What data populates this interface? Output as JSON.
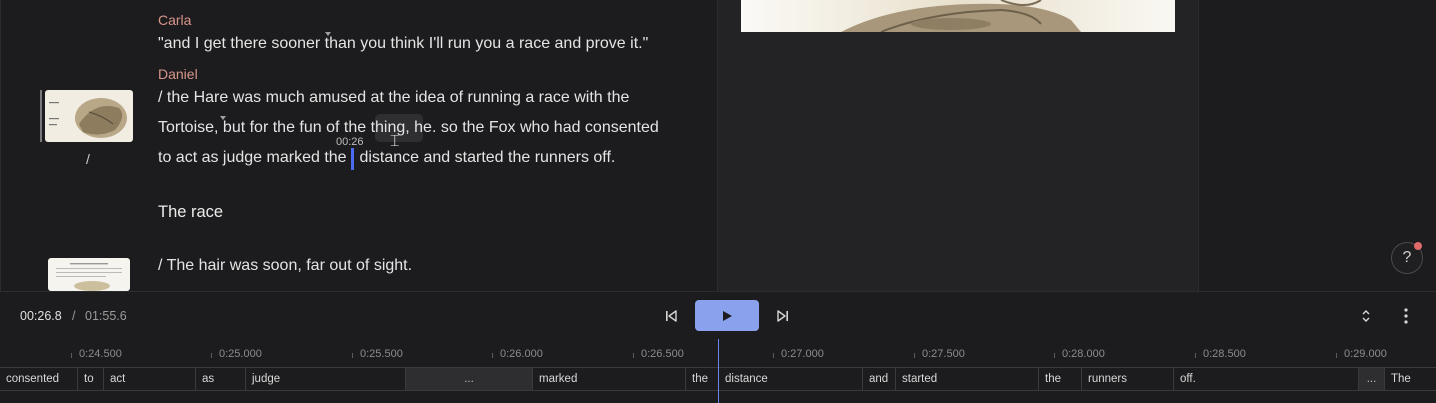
{
  "transcript": {
    "block1": {
      "speaker": "Carla",
      "text": "\"and I get there sooner than you think I'll run you a race and prove it.\""
    },
    "block2": {
      "speaker": "Daniel",
      "line1": "/ the Hare was much amused at the idea of running a race with the",
      "line2": "Tortoise, but for the fun of the thing, he. so the Fox who had consented",
      "line3a": "to act as judge marked the",
      "line3b": "distance and started the runners off.",
      "thumb_label": "/",
      "cursor_time": "00:26"
    },
    "heading": "The race",
    "block3": {
      "text": "/ The hair was soon, far out of sight."
    }
  },
  "player": {
    "current_time": "00:26.8",
    "separator": "/",
    "total_time": "01:55.6"
  },
  "timeline": {
    "ticks": [
      "0:24.500",
      "0:25.000",
      "0:25.500",
      "0:26.000",
      "0:26.500",
      "0:27.000",
      "0:27.500",
      "0:28.000",
      "0:28.500",
      "0:29.000"
    ],
    "words": [
      "consented",
      "to",
      "act",
      "as",
      "judge",
      "...",
      "marked",
      "the",
      "distance",
      "and",
      "started",
      "the",
      "runners",
      "off.",
      "...",
      "The"
    ]
  },
  "help": {
    "label": "?"
  },
  "colors": {
    "accent": "#8aa2ee",
    "speaker": "#d8958c",
    "caret": "#4a6cf0",
    "notification": "#e06a6a"
  },
  "icons": [
    "skip-back-icon",
    "play-icon",
    "skip-forward-icon",
    "expand-collapse-icon",
    "more-vertical-icon",
    "help-icon",
    "text-cursor-icon"
  ]
}
